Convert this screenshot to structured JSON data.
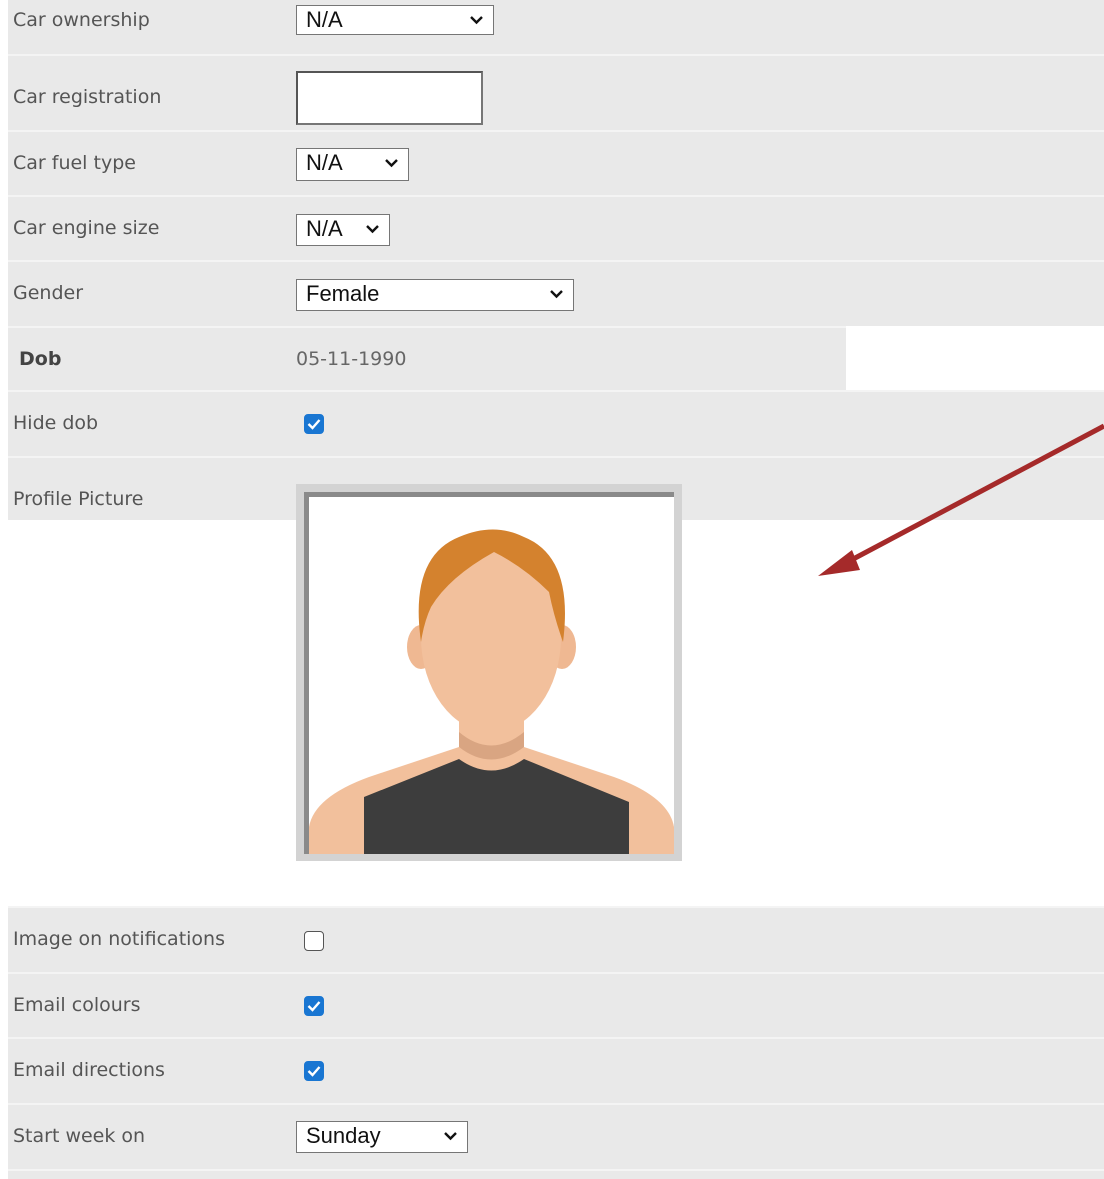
{
  "fields": {
    "car_ownership": {
      "label": "Car ownership",
      "value": "N/A"
    },
    "car_registration": {
      "label": "Car registration",
      "value": ""
    },
    "car_fuel_type": {
      "label": "Car fuel type",
      "value": "N/A"
    },
    "car_engine_size": {
      "label": "Car engine size",
      "value": "N/A"
    },
    "gender": {
      "label": "Gender",
      "value": "Female"
    },
    "dob": {
      "label": "Dob",
      "value": "05-11-1990"
    },
    "hide_dob": {
      "label": "Hide dob",
      "checked": true
    },
    "profile_picture": {
      "label": "Profile Picture"
    },
    "image_on_notifications": {
      "label": "Image on notifications",
      "checked": false
    },
    "email_colours": {
      "label": "Email colours",
      "checked": true
    },
    "email_directions": {
      "label": "Email directions",
      "checked": true
    },
    "start_week_on": {
      "label": "Start week on",
      "value": "Sunday"
    }
  },
  "colors": {
    "row_background": "#e9e9e9",
    "checkbox_checked": "#1976d2",
    "annotation_arrow": "#a52a2a",
    "avatar_hair": "#d4822e",
    "avatar_skin": "#f2c09c",
    "avatar_shirt": "#3d3d3d"
  },
  "icons": {
    "select_chevron": "chevron-down-icon",
    "checkbox_mark": "checkmark-icon",
    "annotation": "red-arrow-icon",
    "avatar": "person-avatar-icon"
  }
}
